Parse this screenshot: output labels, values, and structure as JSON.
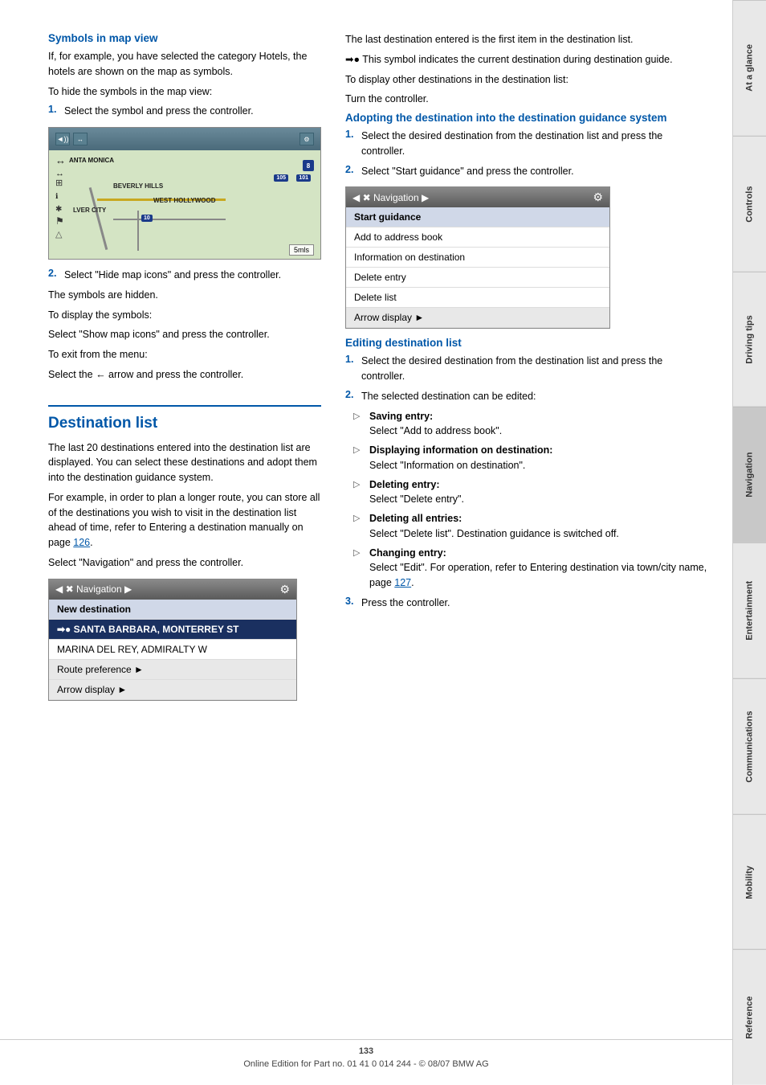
{
  "sidebar": {
    "tabs": [
      {
        "label": "At a glance",
        "active": false
      },
      {
        "label": "Controls",
        "active": false
      },
      {
        "label": "Driving tips",
        "active": false
      },
      {
        "label": "Navigation",
        "active": true
      },
      {
        "label": "Entertainment",
        "active": false
      },
      {
        "label": "Communications",
        "active": false
      },
      {
        "label": "Mobility",
        "active": false
      },
      {
        "label": "Reference",
        "active": false
      }
    ]
  },
  "left_column": {
    "symbols_heading": "Symbols in map view",
    "symbols_body1": "If, for example, you have selected the category Hotels, the hotels are shown on the map as symbols.",
    "symbols_body2": "To hide the symbols in the map view:",
    "step1_symbols": "Select the symbol and press the controller.",
    "step2_symbols": "Select \"Hide map icons\" and press the controller.",
    "hidden_note": "The symbols are hidden.",
    "show_body": "To display the symbols:",
    "show_detail": "Select \"Show map icons\" and press the controller.",
    "exit_body": "To exit from the menu:",
    "exit_detail": "Select the ← arrow and press the controller.",
    "destination_list_heading": "Destination list",
    "dest_body1": "The last 20 destinations entered into the destination list are displayed. You can select these destinations and adopt them into the destination guidance system.",
    "dest_body2": "For example, in order to plan a longer route, you can store all of the destinations you wish to visit in the destination list ahead of time, refer to Entering a destination manually on page 126.",
    "dest_body3": "Select \"Navigation\" and press the controller.",
    "map_header_left": "◄",
    "map_header_title": "Navigation",
    "map_header_right": "►",
    "nav_new_dest": "New destination",
    "nav_santa_barbara": "➡● SANTA BARBARA, MONTERREY ST",
    "nav_marina": "MARINA DEL REY, ADMIRALTY W",
    "nav_route_pref": "Route preference ►",
    "nav_arrow_display": "Arrow display ►",
    "map_label_santa_monica": "ANTA MONICA",
    "map_label_beverly": "BEVERLY HILLS",
    "map_label_culver": "LVER CITY",
    "map_label_hollywood": "WEST HOLLYWOOD",
    "map_scale": "5mls",
    "map_badge_105": "105",
    "map_badge_101": "101",
    "map_badge_10": "10"
  },
  "right_column": {
    "dest_last_note": "The last destination entered is the first item in the destination list.",
    "symbol_note": "➡● This symbol indicates the current destination during destination guide.",
    "display_note": "To display other destinations in the destination list:",
    "display_detail": "Turn the controller.",
    "adopting_heading": "Adopting the destination into the destination guidance system",
    "adopt_step1": "Select the desired destination from the destination list and press the controller.",
    "adopt_step2": "Select \"Start guidance\" and press the controller.",
    "nav2_header_left": "◄",
    "nav2_header_title": "Navigation",
    "nav2_header_right": "►",
    "nav2_header_icon": "⚙",
    "nav2_start_guidance": "Start guidance",
    "nav2_add_address": "Add to address book",
    "nav2_info": "Information on destination",
    "nav2_delete_entry": "Delete entry",
    "nav2_delete_list": "Delete list",
    "nav2_arrow_display": "Arrow display ►",
    "editing_heading": "Editing destination list",
    "edit_step1": "Select the desired destination from the destination list and press the controller.",
    "edit_step2": "The selected destination can be edited:",
    "bullet_saving": "Saving entry:",
    "bullet_saving_detail": "Select \"Add to address book\".",
    "bullet_display": "Displaying information on destination:",
    "bullet_display_detail": "Select \"Information on destination\".",
    "bullet_delete": "Deleting entry:",
    "bullet_delete_detail": "Select \"Delete entry\".",
    "bullet_delete_all": "Deleting all entries:",
    "bullet_delete_all_detail": "Select \"Delete list\". Destination guidance is switched off.",
    "bullet_change": "Changing entry:",
    "bullet_change_detail": "Select \"Edit\". For operation, refer to Entering destination via town/city name, page 127.",
    "edit_step3": "Press the controller.",
    "link_126": "126",
    "link_127": "127"
  },
  "footer": {
    "page_number": "133",
    "copyright": "Online Edition for Part no. 01 41 0 014 244 - © 08/07 BMW AG"
  }
}
